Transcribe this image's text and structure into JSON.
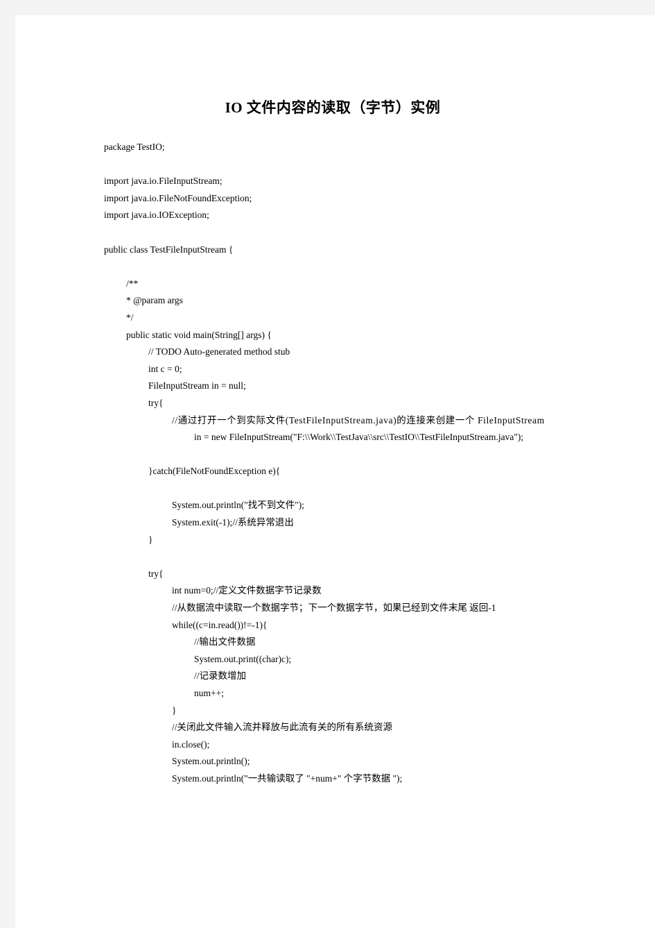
{
  "document": {
    "title_latin": "IO",
    "title_cjk": " 文件内容的读取（字节）实例"
  },
  "code": {
    "lines": [
      {
        "id": "pkg",
        "text": "package TestIO;"
      },
      {
        "id": "blank1",
        "text": ""
      },
      {
        "id": "import1",
        "text": "import java.io.FileInputStream;"
      },
      {
        "id": "import2",
        "text": "import java.io.FileNotFoundException;"
      },
      {
        "id": "import3",
        "text": "import java.io.IOException;"
      },
      {
        "id": "blank2",
        "text": ""
      },
      {
        "id": "class-decl",
        "text": "public class TestFileInputStream {"
      },
      {
        "id": "blank3",
        "text": ""
      },
      {
        "id": "javadoc-open",
        "text": "/**"
      },
      {
        "id": "javadoc-param",
        "text": "* @param args"
      },
      {
        "id": "javadoc-close",
        "text": "*/"
      },
      {
        "id": "main-decl",
        "text": "public static void main(String[] args) {"
      },
      {
        "id": "todo-comment",
        "text": "// TODO Auto-generated method stub"
      },
      {
        "id": "decl-c",
        "text": "int c = 0;"
      },
      {
        "id": "decl-in",
        "text": "FileInputStream in = null;"
      },
      {
        "id": "try1-open",
        "text": "try{"
      },
      {
        "id": "comment-open",
        "text": "//通过打开一个到实际文件(TestFileInputStream.java)的连接来创建一个 FileInputStream"
      },
      {
        "id": "new-stream",
        "text": "in = new FileInputStream(\"F:\\\\Work\\\\TestJava\\\\src\\\\TestIO\\\\TestFileInputStream.java\");"
      },
      {
        "id": "blank4",
        "text": ""
      },
      {
        "id": "catch-open",
        "text": "}catch(FileNotFoundException e){"
      },
      {
        "id": "blank5",
        "text": ""
      },
      {
        "id": "println-nofile",
        "text": "System.out.println(\"找不到文件\");"
      },
      {
        "id": "exit-call",
        "text": "System.exit(-1);//系统异常退出"
      },
      {
        "id": "catch-close",
        "text": "}"
      },
      {
        "id": "blank6",
        "text": ""
      },
      {
        "id": "try2-open",
        "text": "try{"
      },
      {
        "id": "decl-num",
        "text": "int num=0;//定义文件数据字节记录数"
      },
      {
        "id": "comment-read",
        "text": "//从数据流中读取一个数据字节；下一个数据字节，如果已经到文件末尾 返回-1"
      },
      {
        "id": "while-open",
        "text": "while((c=in.read())!=-1){"
      },
      {
        "id": "comment-out",
        "text": "//输出文件数据"
      },
      {
        "id": "print-char",
        "text": "System.out.print((char)c);"
      },
      {
        "id": "comment-count",
        "text": "//记录数增加"
      },
      {
        "id": "num-inc",
        "text": "num++;"
      },
      {
        "id": "while-close",
        "text": "}"
      },
      {
        "id": "comment-close",
        "text": "//关闭此文件输入流并释放与此流有关的所有系统资源"
      },
      {
        "id": "in-close",
        "text": "in.close();"
      },
      {
        "id": "println-empty",
        "text": "System.out.println();"
      },
      {
        "id": "println-total",
        "text": "System.out.println(\"一共输读取了 \"+num+\" 个字节数据 \");"
      }
    ]
  }
}
